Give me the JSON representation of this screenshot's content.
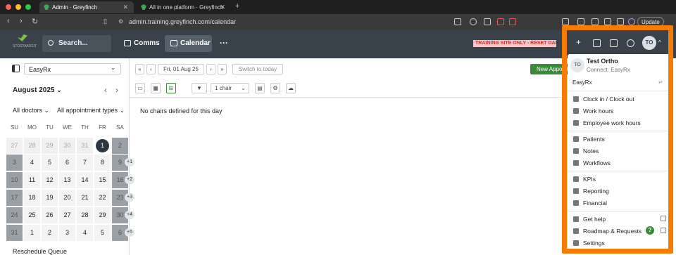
{
  "browser": {
    "tabs": [
      {
        "label": "Admin · Greyfinch"
      },
      {
        "label": "All in one platform · Greyfinch"
      }
    ],
    "url": "admin.training.greyfinch.com/calendar",
    "update_label": "Update"
  },
  "app": {
    "logo_text": "STOSTAAREIT",
    "search_label": "Search...",
    "nav": [
      {
        "label": "Comms"
      },
      {
        "label": "Calendar"
      }
    ],
    "more_label": "···",
    "banner": "TRAINING SITE ONLY - RESET DAILY",
    "avatar_initials": "TO"
  },
  "sidebar": {
    "clinic": "EasyRx",
    "month_label": "August 2025",
    "filter_doctors": "All doctors",
    "filter_appts": "All appointment types",
    "weekdays": [
      "SU",
      "MO",
      "TU",
      "WE",
      "TH",
      "FR",
      "SA"
    ],
    "weeks": [
      [
        "27",
        "28",
        "29",
        "30",
        "31",
        "1",
        "2"
      ],
      [
        "3",
        "4",
        "5",
        "6",
        "7",
        "8",
        "9"
      ],
      [
        "10",
        "11",
        "12",
        "13",
        "14",
        "15",
        "16"
      ],
      [
        "17",
        "18",
        "19",
        "20",
        "21",
        "22",
        "23"
      ],
      [
        "24",
        "25",
        "26",
        "27",
        "28",
        "29",
        "30"
      ],
      [
        "31",
        "1",
        "2",
        "3",
        "4",
        "5",
        "6"
      ]
    ],
    "more_badges": [
      "+1",
      "+2",
      "+3",
      "+4",
      "+5"
    ],
    "reschedule_label": "Reschedule Queue"
  },
  "toolbar": {
    "date_label": "Fri, 01 Aug 25",
    "switch_today": "Switch to today",
    "chair_select": "1 chair",
    "new_appt": "New Appointment"
  },
  "main": {
    "empty_message": "No chairs defined for this day"
  },
  "menu": {
    "user_initials": "TO",
    "user_name": "Test Ortho",
    "connection": "Connect: EasyRx",
    "clinic": "EasyRx",
    "group1": [
      {
        "label": "Clock in / Clock out",
        "icon": "clock-in-icon"
      },
      {
        "label": "Work hours",
        "icon": "pie-clock-icon"
      },
      {
        "label": "Employee work hours",
        "icon": "timesheet-icon"
      }
    ],
    "group2": [
      {
        "label": "Patients",
        "icon": "patient-icon"
      },
      {
        "label": "Notes",
        "icon": "notes-icon"
      },
      {
        "label": "Workflows",
        "icon": "workflow-icon"
      }
    ],
    "group3": [
      {
        "label": "KPIs",
        "icon": "kpi-icon"
      },
      {
        "label": "Reporting",
        "icon": "chart-icon"
      },
      {
        "label": "Financial",
        "icon": "dollar-icon"
      }
    ],
    "group4": [
      {
        "label": "Get help",
        "icon": "help-icon"
      },
      {
        "label": "Roadmap & Requests",
        "icon": "roadmap-icon"
      },
      {
        "label": "Settings",
        "icon": "gear-icon"
      }
    ]
  }
}
